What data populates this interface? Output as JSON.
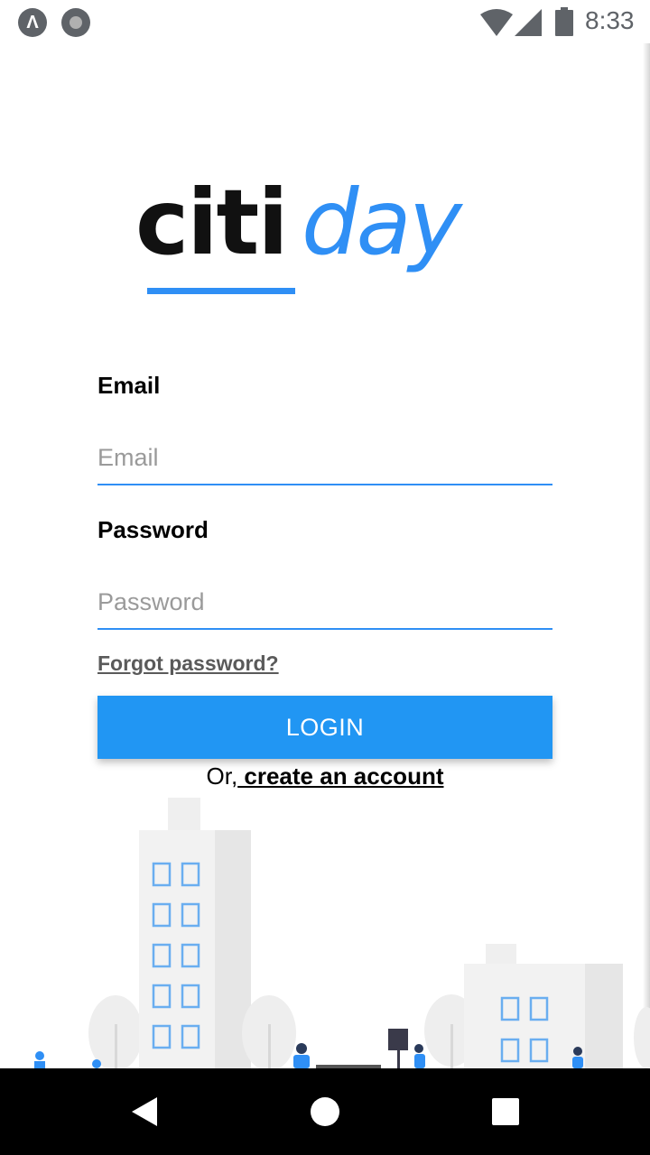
{
  "status_bar": {
    "time": "8:33",
    "left_icons": [
      "expo-icon",
      "record-icon"
    ],
    "right_icons": [
      "wifi-icon",
      "signal-icon",
      "battery-icon"
    ]
  },
  "logo": {
    "part_black": "citi",
    "part_blue": "day",
    "colors": {
      "black": "#111111",
      "blue": "#2f8ff5"
    }
  },
  "form": {
    "email_label": "Email",
    "email_placeholder": "Email",
    "email_value": "",
    "password_label": "Password",
    "password_placeholder": "Password",
    "password_value": "",
    "forgot_label": "Forgot password?",
    "login_label": "LOGIN",
    "signup_prefix": "Or,",
    "signup_link": " create an account"
  },
  "nav_bar": {
    "buttons": [
      "back-icon",
      "home-icon",
      "recents-icon"
    ]
  },
  "colors": {
    "accent": "#2196f3",
    "input_underline": "#2f8ff5"
  }
}
